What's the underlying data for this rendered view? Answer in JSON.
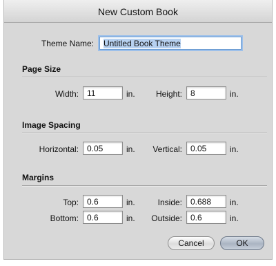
{
  "window": {
    "title": "New Custom Book"
  },
  "theme": {
    "label": "Theme Name:",
    "value": "Untitled Book Theme"
  },
  "page_size": {
    "heading": "Page Size",
    "width_label": "Width:",
    "width_value": "11",
    "width_unit": "in.",
    "height_label": "Height:",
    "height_value": "8",
    "height_unit": "in."
  },
  "image_spacing": {
    "heading": "Image Spacing",
    "horizontal_label": "Horizontal:",
    "horizontal_value": "0.05",
    "horizontal_unit": "in.",
    "vertical_label": "Vertical:",
    "vertical_value": "0.05",
    "vertical_unit": "in."
  },
  "margins": {
    "heading": "Margins",
    "top_label": "Top:",
    "top_value": "0.6",
    "top_unit": "in.",
    "inside_label": "Inside:",
    "inside_value": "0.688",
    "inside_unit": "in.",
    "bottom_label": "Bottom:",
    "bottom_value": "0.6",
    "bottom_unit": "in.",
    "outside_label": "Outside:",
    "outside_value": "0.6",
    "outside_unit": "in."
  },
  "buttons": {
    "cancel_label": "Cancel",
    "ok_label": "OK"
  }
}
